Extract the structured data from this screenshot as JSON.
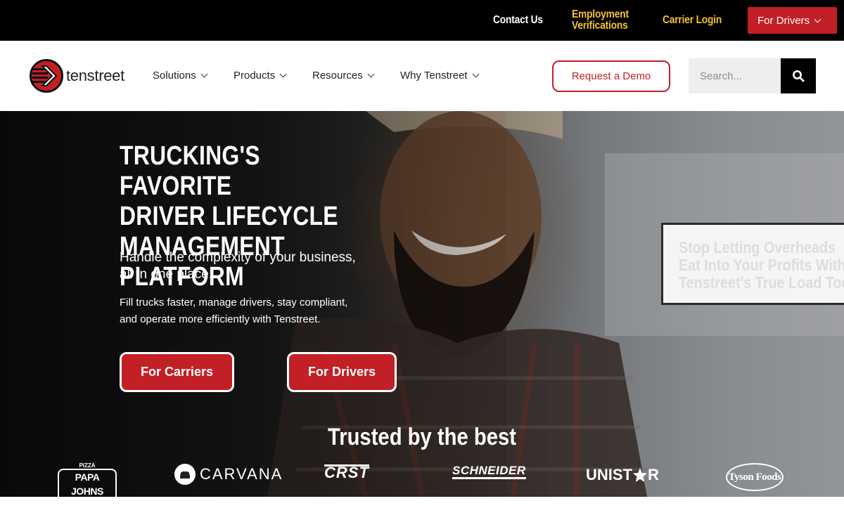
{
  "topbar": {
    "contact": "Contact Us",
    "employment_line1": "Employment",
    "employment_line2": "Verifications",
    "carrier_login": "Carrier Login",
    "for_drivers": "For Drivers"
  },
  "nav": {
    "logo_text": "tenstreet",
    "items": [
      "Solutions",
      "Products",
      "Resources",
      "Why Tenstreet"
    ],
    "demo": "Request a Demo",
    "search_placeholder": "Search..."
  },
  "hero": {
    "title_line1": "TRUCKING'S FAVORITE",
    "title_line2": "DRIVER LIFECYCLE",
    "title_line3": "MANAGEMENT PLATFORM",
    "sub_line1": "Handle the complexity of your business,",
    "sub_line2": "all in one place.",
    "body_line1": "Fill trucks faster, manage drivers, stay compliant,",
    "body_line2": "and operate more efficiently with Tenstreet.",
    "cta_carriers": "For Carriers",
    "cta_drivers": "For Drivers",
    "promo_line1": "Stop Letting Overheads",
    "promo_line2": "Eat Into Your Profits With",
    "promo_line3": "Tenstreet's True Load Tool",
    "trusted": "Trusted by the best"
  },
  "brands": {
    "papa_small": "PIZZA",
    "papa": "PAPA JOHNS",
    "carvana": "CARVANA",
    "crst": "CRST",
    "schneider": "SCHNEIDER",
    "unistar_a": "UNIST",
    "unistar_b": "R",
    "tyson": "Tyson Foods"
  },
  "colors": {
    "brand_red": "#c31f26",
    "accent_yellow": "#f2c230"
  }
}
